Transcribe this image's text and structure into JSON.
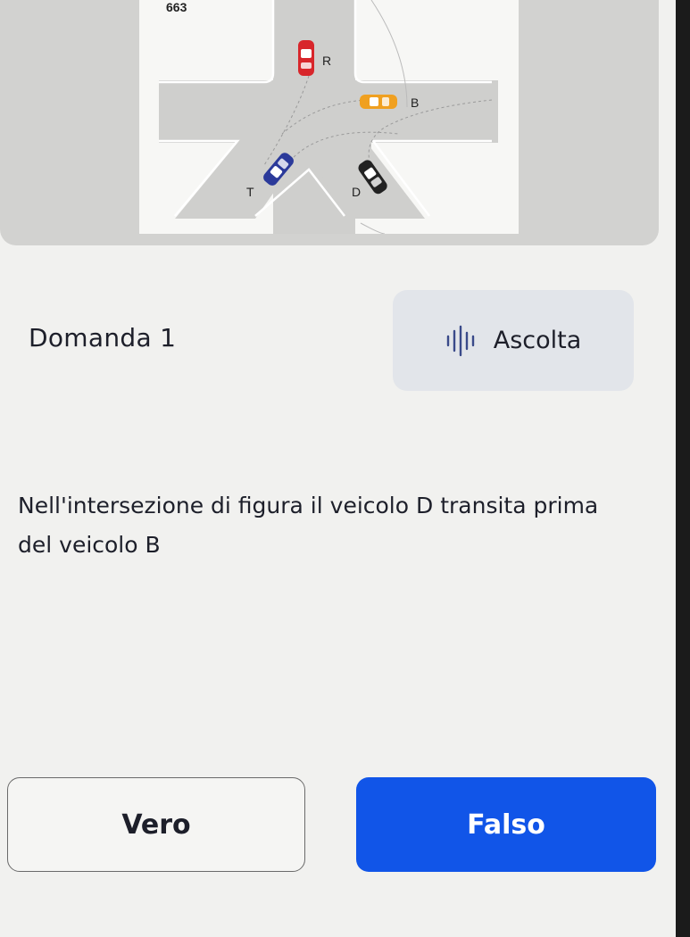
{
  "figure": {
    "number": "663",
    "vehicle_labels": {
      "r": "R",
      "b": "B",
      "t": "T",
      "d": "D"
    }
  },
  "question": {
    "label": "Domanda 1",
    "text": "Nell'intersezione di figura il veicolo D transita prima del veicolo B"
  },
  "listen": {
    "label": "Ascolta",
    "icon": "audio-waveform-icon"
  },
  "answers": {
    "true_label": "Vero",
    "false_label": "Falso"
  },
  "colors": {
    "primary": "#1155e8",
    "road": "#cfcfcd",
    "vehicle_r": "#d8262b",
    "vehicle_b": "#f0a020",
    "vehicle_t": "#2b3a9a",
    "vehicle_d": "#222222"
  }
}
